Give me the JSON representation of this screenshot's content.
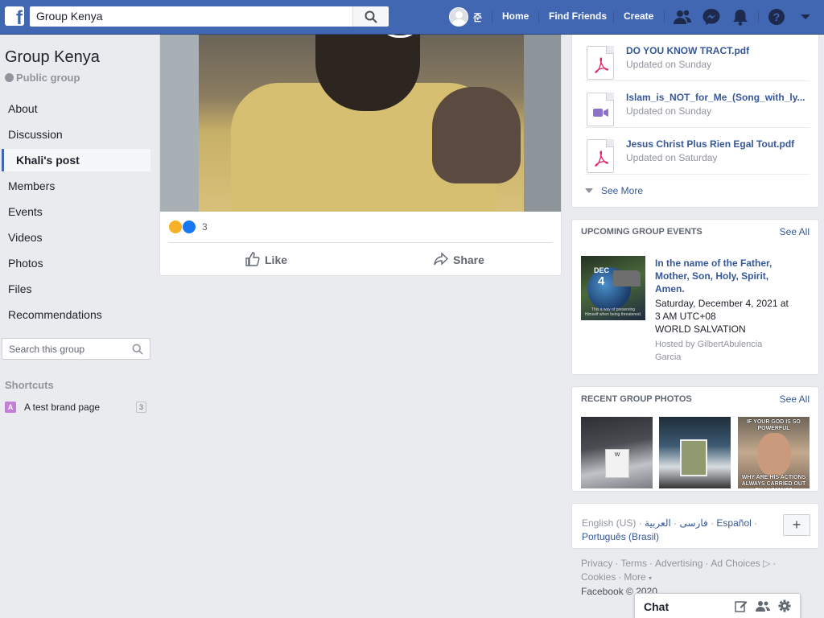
{
  "header": {
    "search_value": "Group Kenya",
    "user_name": "준",
    "nav": [
      "Home",
      "Find Friends",
      "Create"
    ]
  },
  "group": {
    "title": "Group Kenya",
    "type": "Public group"
  },
  "leftnav": {
    "items": [
      "About",
      "Discussion",
      "Khali's post",
      "Members",
      "Events",
      "Videos",
      "Photos",
      "Files",
      "Recommendations"
    ],
    "active_index": 2
  },
  "group_search": {
    "placeholder": "Search this group"
  },
  "shortcuts": {
    "title": "Shortcuts",
    "items": [
      {
        "initial": "A",
        "label": "A test brand page",
        "count": "3"
      }
    ]
  },
  "post": {
    "reaction_count": "3",
    "like_label": "Like",
    "share_label": "Share"
  },
  "files": {
    "items": [
      {
        "name": "DO YOU KNOW TRACT.pdf",
        "updated": "Updated on Sunday",
        "type": "pdf"
      },
      {
        "name": "Islam_is_NOT_for_Me_(Song_with_ly...",
        "updated": "Updated on Sunday",
        "type": "video"
      },
      {
        "name": "Jesus Christ Plus Rien Egal Tout.pdf",
        "updated": "Updated on Saturday",
        "type": "pdf"
      }
    ],
    "see_more": "See More"
  },
  "events": {
    "title": "UPCOMING GROUP EVENTS",
    "see_all": "See All",
    "item": {
      "month": "DEC",
      "day": "4",
      "caption": "This a way of preserving Himself when being threatened.",
      "name": "In the name of the Father, Mother, Son, Holy, Spirit, Amen.",
      "date": "Saturday, December 4, 2021 at 3 AM UTC+08",
      "place": "WORLD SALVATION",
      "host": "Hosted by GilbertAbulencia Garcia"
    }
  },
  "photos": {
    "title": "RECENT GROUP PHOTOS",
    "see_all": "See All",
    "meme_top": "IF YOUR GOD IS SO POWERFUL",
    "meme_bottom": "WHY ARE HIS ACTIONS ALWAYS CARRIED OUT BY HUMANS?"
  },
  "languages": {
    "current": "English (US)",
    "others": [
      "فارسی",
      "العربية",
      "Español",
      "Português (Brasil)"
    ]
  },
  "footer": {
    "links": [
      "Privacy",
      "Terms",
      "Advertising",
      "Ad Choices",
      "Cookies",
      "More"
    ],
    "copyright": "Facebook © 2020"
  },
  "chat": {
    "label": "Chat"
  },
  "colors": {
    "brand": "#4267b2",
    "link": "#365899",
    "page_bg": "#e9ebee"
  }
}
